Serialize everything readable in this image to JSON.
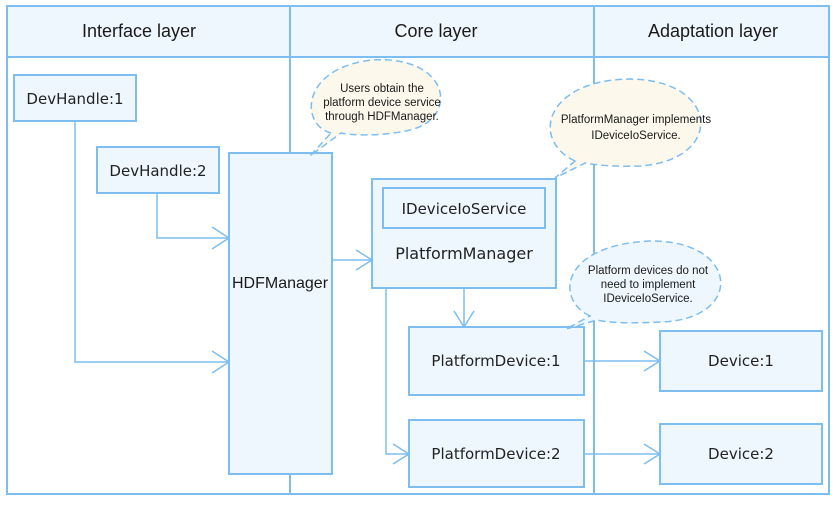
{
  "layers": {
    "interface": "Interface layer",
    "core": "Core layer",
    "adaptation": "Adaptation layer"
  },
  "nodes": {
    "devhandle1": "DevHandle:1",
    "devhandle2": "DevHandle:2",
    "hdfmanager": "HDFManager",
    "ideviceioservice": "IDeviceIoService",
    "platformmanager": "PlatformManager",
    "platformdevice1": "PlatformDevice:1",
    "platformdevice2": "PlatformDevice:2",
    "device1": "Device:1",
    "device2": "Device:2"
  },
  "notes": {
    "hdf": [
      "Users obtain the",
      "platform device service",
      "through HDFManager."
    ],
    "pm": [
      "PlatformManager implements",
      "IDeviceIoService."
    ],
    "pd": [
      "Platform devices do not",
      "need to implement",
      "IDeviceIoService."
    ]
  },
  "colors": {
    "line": "#7dbdf0",
    "box_fill": "#eef7fe",
    "note_warm": "#fdf8ec",
    "note_cool": "#eef7fe"
  }
}
